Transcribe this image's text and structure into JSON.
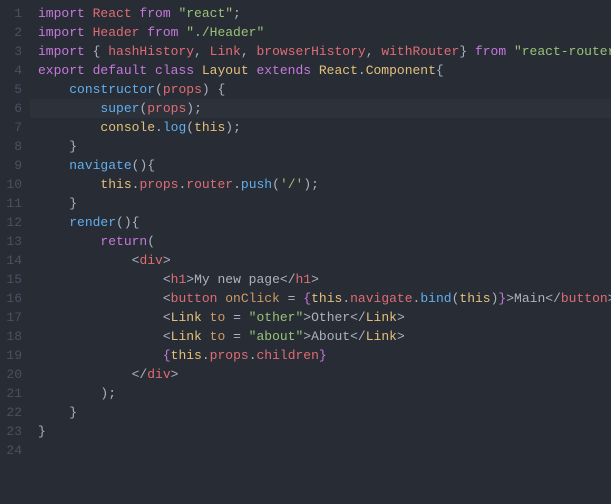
{
  "lineNumbers": [
    "1",
    "2",
    "3",
    "4",
    "5",
    "6",
    "7",
    "8",
    "9",
    "10",
    "11",
    "12",
    "13",
    "14",
    "15",
    "16",
    "17",
    "18",
    "19",
    "20",
    "21",
    "22",
    "23",
    "24"
  ],
  "highlightedLine": 6,
  "code": {
    "line1": [
      {
        "t": "import ",
        "c": "kw"
      },
      {
        "t": "React ",
        "c": "var"
      },
      {
        "t": "from ",
        "c": "kw"
      },
      {
        "t": "\"react\"",
        "c": "str"
      },
      {
        "t": ";",
        "c": "punct"
      }
    ],
    "line2": [
      {
        "t": "import ",
        "c": "kw"
      },
      {
        "t": "Header ",
        "c": "var"
      },
      {
        "t": "from ",
        "c": "kw"
      },
      {
        "t": "\"./Header\"",
        "c": "str"
      }
    ],
    "line3": [
      {
        "t": "import ",
        "c": "kw"
      },
      {
        "t": "{ ",
        "c": "brace"
      },
      {
        "t": "hashHistory",
        "c": "var"
      },
      {
        "t": ", ",
        "c": "punct"
      },
      {
        "t": "Link",
        "c": "var"
      },
      {
        "t": ", ",
        "c": "punct"
      },
      {
        "t": "browserHistory",
        "c": "var"
      },
      {
        "t": ", ",
        "c": "punct"
      },
      {
        "t": "withRouter",
        "c": "var"
      },
      {
        "t": "} ",
        "c": "brace"
      },
      {
        "t": "from ",
        "c": "kw"
      },
      {
        "t": "\"react-router\"",
        "c": "str"
      },
      {
        "t": ";",
        "c": "punct"
      }
    ],
    "line4": [
      {
        "t": "export ",
        "c": "kw"
      },
      {
        "t": "default ",
        "c": "kw"
      },
      {
        "t": "class ",
        "c": "kw"
      },
      {
        "t": "Layout ",
        "c": "cls"
      },
      {
        "t": "extends ",
        "c": "kw"
      },
      {
        "t": "React",
        "c": "cls"
      },
      {
        "t": ".",
        "c": "punct"
      },
      {
        "t": "Component",
        "c": "cls"
      },
      {
        "t": "{",
        "c": "brace"
      }
    ],
    "line5": [
      {
        "t": "    ",
        "c": ""
      },
      {
        "t": "constructor",
        "c": "fn"
      },
      {
        "t": "(",
        "c": "brace"
      },
      {
        "t": "props",
        "c": "var"
      },
      {
        "t": ") {",
        "c": "brace"
      }
    ],
    "line6": [
      {
        "t": "        ",
        "c": ""
      },
      {
        "t": "super",
        "c": "fn"
      },
      {
        "t": "(",
        "c": "brace"
      },
      {
        "t": "props",
        "c": "var"
      },
      {
        "t": ");",
        "c": "brace"
      }
    ],
    "line7": [
      {
        "t": "        ",
        "c": ""
      },
      {
        "t": "console",
        "c": "cls"
      },
      {
        "t": ".",
        "c": "punct"
      },
      {
        "t": "log",
        "c": "fn"
      },
      {
        "t": "(",
        "c": "brace"
      },
      {
        "t": "this",
        "c": "this"
      },
      {
        "t": ");",
        "c": "brace"
      }
    ],
    "line8": [
      {
        "t": "    }",
        "c": "brace"
      }
    ],
    "line9": [
      {
        "t": "    ",
        "c": ""
      },
      {
        "t": "navigate",
        "c": "fn"
      },
      {
        "t": "(){",
        "c": "brace"
      }
    ],
    "line10": [
      {
        "t": "        ",
        "c": ""
      },
      {
        "t": "this",
        "c": "this"
      },
      {
        "t": ".",
        "c": "punct"
      },
      {
        "t": "props",
        "c": "prop"
      },
      {
        "t": ".",
        "c": "punct"
      },
      {
        "t": "router",
        "c": "prop"
      },
      {
        "t": ".",
        "c": "punct"
      },
      {
        "t": "push",
        "c": "fn"
      },
      {
        "t": "(",
        "c": "brace"
      },
      {
        "t": "'/'",
        "c": "str"
      },
      {
        "t": ");",
        "c": "brace"
      }
    ],
    "line11": [
      {
        "t": "    }",
        "c": "brace"
      }
    ],
    "line12": [
      {
        "t": "    ",
        "c": ""
      },
      {
        "t": "render",
        "c": "fn"
      },
      {
        "t": "(){",
        "c": "brace"
      }
    ],
    "line13": [
      {
        "t": "        ",
        "c": ""
      },
      {
        "t": "return",
        "c": "kw"
      },
      {
        "t": "(",
        "c": "brace"
      }
    ],
    "line14": [
      {
        "t": "            ",
        "c": ""
      },
      {
        "t": "<",
        "c": "tagbracket"
      },
      {
        "t": "div",
        "c": "tag"
      },
      {
        "t": ">",
        "c": "tagbracket"
      }
    ],
    "line15": [
      {
        "t": "                ",
        "c": ""
      },
      {
        "t": "<",
        "c": "tagbracket"
      },
      {
        "t": "h1",
        "c": "tag"
      },
      {
        "t": ">",
        "c": "tagbracket"
      },
      {
        "t": "My new page",
        "c": "punct"
      },
      {
        "t": "</",
        "c": "tagbracket"
      },
      {
        "t": "h1",
        "c": "tag"
      },
      {
        "t": ">",
        "c": "tagbracket"
      }
    ],
    "line16": [
      {
        "t": "                ",
        "c": ""
      },
      {
        "t": "<",
        "c": "tagbracket"
      },
      {
        "t": "button ",
        "c": "tag"
      },
      {
        "t": "onClick ",
        "c": "attr"
      },
      {
        "t": "= ",
        "c": "punct"
      },
      {
        "t": "{",
        "c": "jsx-brace"
      },
      {
        "t": "this",
        "c": "this"
      },
      {
        "t": ".",
        "c": "punct"
      },
      {
        "t": "navigate",
        "c": "prop"
      },
      {
        "t": ".",
        "c": "punct"
      },
      {
        "t": "bind",
        "c": "fn"
      },
      {
        "t": "(",
        "c": "brace"
      },
      {
        "t": "this",
        "c": "this"
      },
      {
        "t": ")",
        "c": "brace"
      },
      {
        "t": "}",
        "c": "jsx-brace"
      },
      {
        "t": ">",
        "c": "tagbracket"
      },
      {
        "t": "Main",
        "c": "punct"
      },
      {
        "t": "</",
        "c": "tagbracket"
      },
      {
        "t": "button",
        "c": "tag"
      },
      {
        "t": ">",
        "c": "tagbracket"
      }
    ],
    "line17": [
      {
        "t": "                ",
        "c": ""
      },
      {
        "t": "<",
        "c": "tagbracket"
      },
      {
        "t": "Link ",
        "c": "cls"
      },
      {
        "t": "to ",
        "c": "attr"
      },
      {
        "t": "= ",
        "c": "punct"
      },
      {
        "t": "\"other\"",
        "c": "str"
      },
      {
        "t": ">",
        "c": "tagbracket"
      },
      {
        "t": "Other",
        "c": "punct"
      },
      {
        "t": "</",
        "c": "tagbracket"
      },
      {
        "t": "Link",
        "c": "cls"
      },
      {
        "t": ">",
        "c": "tagbracket"
      }
    ],
    "line18": [
      {
        "t": "                ",
        "c": ""
      },
      {
        "t": "<",
        "c": "tagbracket"
      },
      {
        "t": "Link ",
        "c": "cls"
      },
      {
        "t": "to ",
        "c": "attr"
      },
      {
        "t": "= ",
        "c": "punct"
      },
      {
        "t": "\"about\"",
        "c": "str"
      },
      {
        "t": ">",
        "c": "tagbracket"
      },
      {
        "t": "About",
        "c": "punct"
      },
      {
        "t": "</",
        "c": "tagbracket"
      },
      {
        "t": "Link",
        "c": "cls"
      },
      {
        "t": ">",
        "c": "tagbracket"
      }
    ],
    "line19": [
      {
        "t": "                ",
        "c": ""
      },
      {
        "t": "{",
        "c": "jsx-brace"
      },
      {
        "t": "this",
        "c": "this"
      },
      {
        "t": ".",
        "c": "punct"
      },
      {
        "t": "props",
        "c": "prop"
      },
      {
        "t": ".",
        "c": "punct"
      },
      {
        "t": "children",
        "c": "prop"
      },
      {
        "t": "}",
        "c": "jsx-brace"
      }
    ],
    "line20": [
      {
        "t": "            ",
        "c": ""
      },
      {
        "t": "</",
        "c": "tagbracket"
      },
      {
        "t": "div",
        "c": "tag"
      },
      {
        "t": ">",
        "c": "tagbracket"
      }
    ],
    "line21": [
      {
        "t": "        );",
        "c": "brace"
      }
    ],
    "line22": [
      {
        "t": "    }",
        "c": "brace"
      }
    ],
    "line23": [
      {
        "t": "}",
        "c": "brace"
      }
    ],
    "line24": [
      {
        "t": "",
        "c": ""
      }
    ]
  }
}
